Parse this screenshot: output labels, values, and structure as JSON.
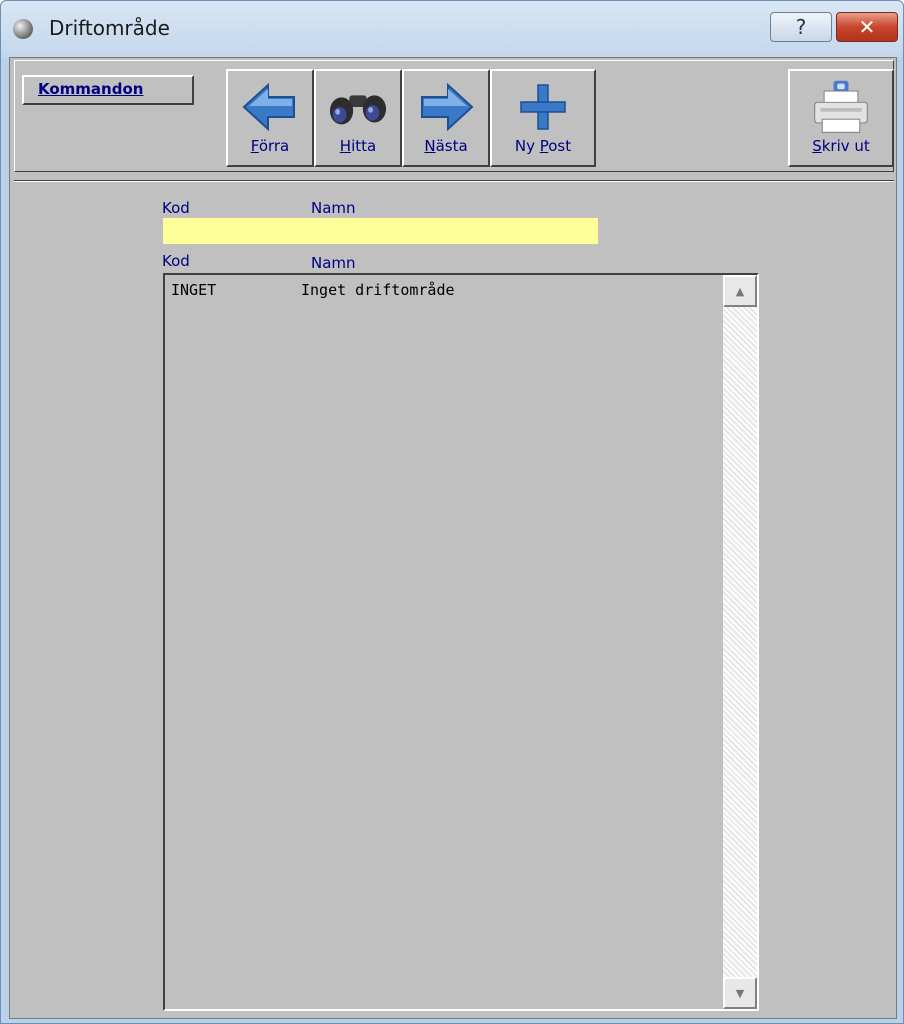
{
  "window": {
    "title": "Driftområde",
    "help_glyph": "?",
    "close_glyph": "✕"
  },
  "toolbar": {
    "commands_label": "Kommandon",
    "buttons": [
      {
        "icon": "left-arrow-icon",
        "label_first": "F",
        "label_rest": "örra"
      },
      {
        "icon": "binoculars-icon",
        "label_first": "H",
        "label_rest": "itta"
      },
      {
        "icon": "right-arrow-icon",
        "label_first": "N",
        "label_rest": "ästa"
      },
      {
        "icon": "plus-icon",
        "label_pre": "Ny ",
        "label_first": "P",
        "label_rest": "ost"
      },
      {
        "icon": "printer-icon",
        "label_first": "S",
        "label_rest": "kriv ut"
      }
    ]
  },
  "search": {
    "kod_label": "Kod",
    "namn_label": "Namn",
    "kod_value": "",
    "namn_value": ""
  },
  "list": {
    "kod_header": "Kod",
    "namn_header": "Namn",
    "rows": [
      {
        "kod": "INGET",
        "namn": "Inget driftområde"
      }
    ]
  },
  "colors": {
    "field_bg": "#ffff99",
    "label_blue": "#00007f",
    "arrow_blue": "#3a78c8"
  }
}
